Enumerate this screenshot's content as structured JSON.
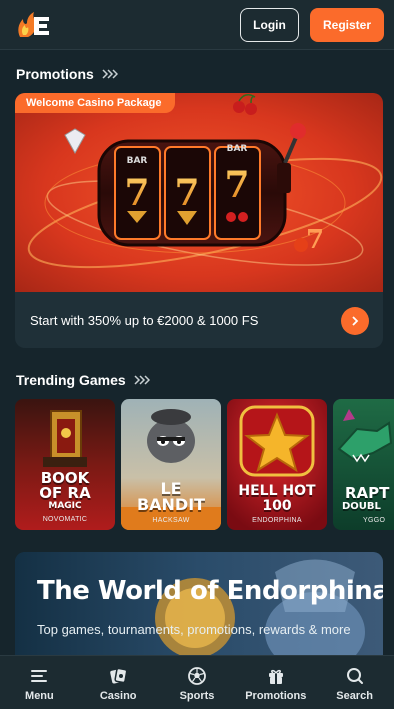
{
  "header": {
    "logo_icon": "flame-e-logo",
    "login_label": "Login",
    "register_label": "Register"
  },
  "promotions": {
    "title": "Promotions",
    "card": {
      "tag": "Welcome Casino Package",
      "text": "Start with 350% up to €2000 & 1000 FS",
      "arrow_icon": "chevron-right-icon"
    }
  },
  "trending": {
    "title": "Trending Games",
    "games": [
      {
        "title_line1": "BOOK",
        "title_line2": "OF RA",
        "title_line3": "MAGIC",
        "provider": "NOVOMATIC"
      },
      {
        "title_line1": "LE",
        "title_line2": "BANDIT",
        "provider": "HACKSAW"
      },
      {
        "title_line1": "HELL HOT",
        "title_line2": "100",
        "provider": "ENDORPHINA"
      },
      {
        "title_line1": "RAPT",
        "title_line2": "DOUBL",
        "provider": "YGGO"
      }
    ]
  },
  "world": {
    "title": "The World of Endorphina",
    "description": "Top games, tournaments, promotions, rewards & more"
  },
  "nav": {
    "items": [
      {
        "label": "Menu",
        "icon": "menu-icon"
      },
      {
        "label": "Casino",
        "icon": "casino-icon"
      },
      {
        "label": "Sports",
        "icon": "soccer-ball-icon"
      },
      {
        "label": "Promotions",
        "icon": "gift-icon"
      },
      {
        "label": "Search",
        "icon": "search-icon"
      }
    ]
  },
  "colors": {
    "background": "#16252c",
    "header": "#1c2b31",
    "accent": "#fb6b2b",
    "card": "#1f3038"
  }
}
